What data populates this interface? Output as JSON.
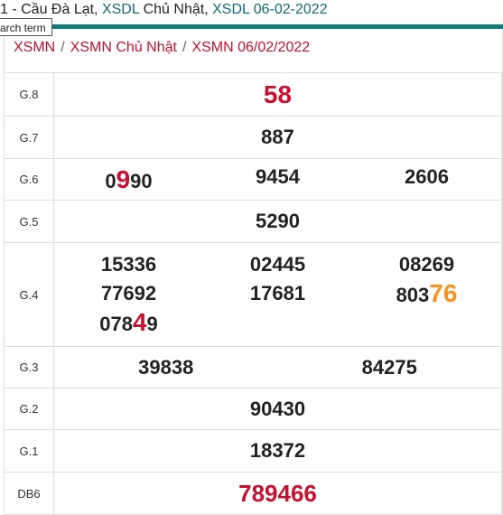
{
  "header": {
    "prefix": "1 - Cầu Đà Lạt, ",
    "link1": "XSDL",
    "mid1": " Chủ Nhật, ",
    "link2": "XSDL 06-02-2022"
  },
  "tooltip": {
    "text": "arch term"
  },
  "breadcrumb": [
    "XSMN",
    "XSMN Chủ Nhật",
    "XSMN 06/02/2022"
  ],
  "breadcrumb_separator": "/",
  "colors": {
    "accent_teal": "#137a7a",
    "red": "#c8102e",
    "orange": "#f7941d",
    "text": "#222222"
  },
  "results": {
    "g8": {
      "label": "G.8",
      "value": "58"
    },
    "g7": {
      "label": "G.7",
      "value": "887"
    },
    "g6": {
      "label": "G.6",
      "values": [
        "0990",
        "9454",
        "2606"
      ],
      "v1_parts": [
        "0",
        "9",
        "90"
      ]
    },
    "g5": {
      "label": "G.5",
      "value": "5290"
    },
    "g4": {
      "label": "G.4",
      "values": [
        "15336",
        "77692",
        "07849",
        "02445",
        "17681",
        "08269",
        "80376"
      ],
      "v3_parts": [
        "078",
        "4",
        "9"
      ],
      "v7_parts": [
        "803",
        "76"
      ]
    },
    "g3": {
      "label": "G.3",
      "values": [
        "39838",
        "84275"
      ]
    },
    "g2": {
      "label": "G.2",
      "value": "90430"
    },
    "g1": {
      "label": "G.1",
      "value": "18372"
    },
    "db": {
      "label": "DB6",
      "value": "789466"
    }
  }
}
